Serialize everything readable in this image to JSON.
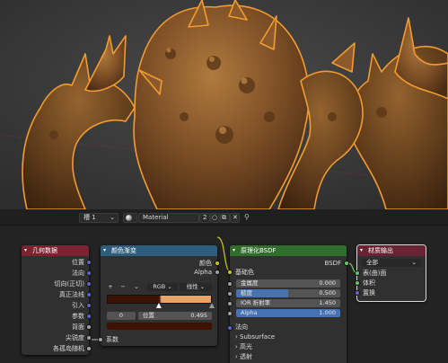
{
  "viewport": {
    "description_icon": "3d-sculpted-creature-viewport"
  },
  "header": {
    "slot_label": "槽 1",
    "material_name": "Material",
    "user_count": "2"
  },
  "nodes": {
    "geometry": {
      "title": "几何数据",
      "outputs": [
        "位置",
        "法向",
        "切向(正切)",
        "真正法线",
        "引入",
        "参数",
        "背面",
        "尖锐度",
        "各孤岛随机"
      ]
    },
    "color_ramp": {
      "title": "颜色渐变",
      "out_color": "颜色",
      "out_alpha": "Alpha",
      "mode": "RGB",
      "interpolation": "线性",
      "stop_index": "0",
      "position_label": "位置",
      "position_value": "0.495",
      "input_factor": "系数"
    },
    "principled": {
      "title": "原理化BSDF",
      "out_bsdf": "BSDF",
      "base_color": "基础色",
      "metallic_label": "金属度",
      "metallic_value": "0.000",
      "roughness_label": "糙度",
      "roughness_value": "0.500",
      "ior_label": "IOR 折射率",
      "ior_value": "1.450",
      "alpha_label": "Alpha",
      "alpha_value": "1.000",
      "normal": "法向",
      "subsurface": "Subsurface",
      "specular": "高光",
      "transmission": "透射"
    },
    "output": {
      "title": "材质输出",
      "target": "全部",
      "surface": "表(曲)面",
      "volume": "体积",
      "displacement": "置换"
    }
  },
  "ramp_stop_position": 0.495,
  "roughness_fill": 0.5,
  "colors": {
    "geometry_header": "#7a2432",
    "color_ramp_header": "#2d5e7e",
    "principled_header": "#2f6e2b",
    "output_header": "#6a2334",
    "vector_socket": "#6363c7",
    "color_socket": "#c7c729",
    "float_socket": "#a1a1a1",
    "shader_socket": "#63c763",
    "slider_blue": "#4772b3",
    "selection_outline": "#f29b30"
  }
}
